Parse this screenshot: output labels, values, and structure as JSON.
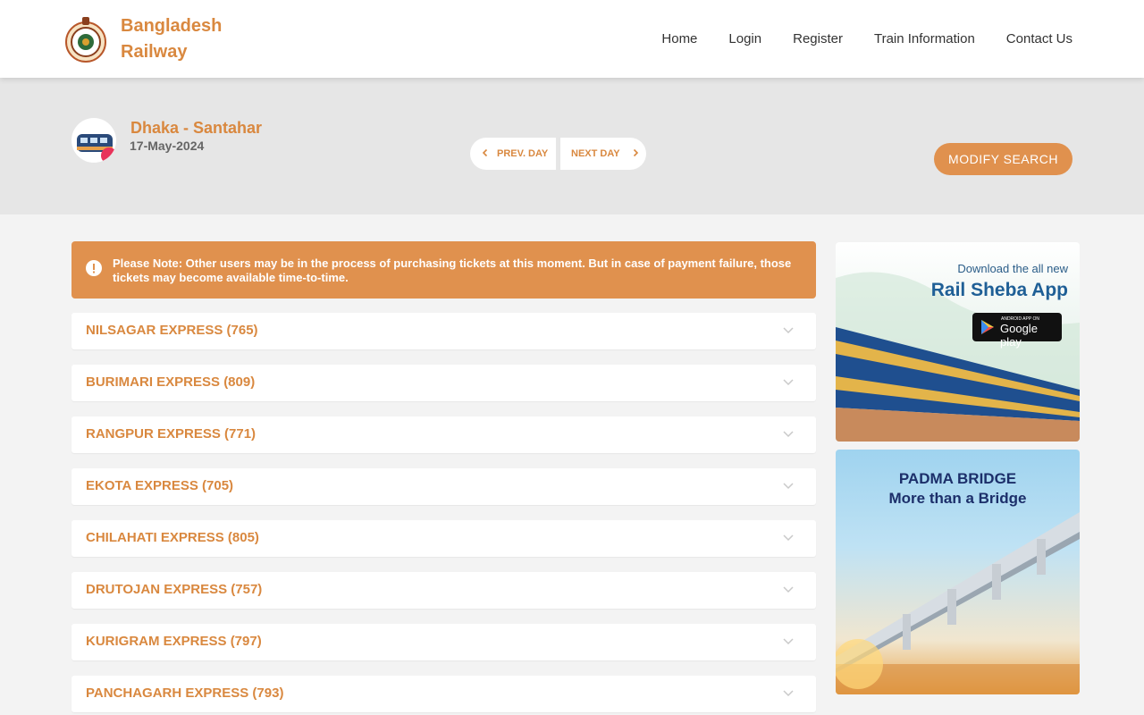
{
  "header": {
    "brand_line1": "Bangladesh",
    "brand_line2": "Railway",
    "nav": [
      {
        "label": "Home"
      },
      {
        "label": "Login"
      },
      {
        "label": "Register"
      },
      {
        "label": "Train Information"
      },
      {
        "label": "Contact Us"
      }
    ]
  },
  "journey": {
    "route": "Dhaka - Santahar",
    "date": "17-May-2024",
    "prev_day": "PREV. DAY",
    "next_day": "NEXT DAY",
    "modify_search": "MODIFY SEARCH"
  },
  "notice": {
    "text": "Please Note: Other users may be in the process of purchasing tickets at this moment. But in case of payment failure, those tickets may become available time-to-time."
  },
  "trains": [
    {
      "name": "NILSAGAR EXPRESS (765)"
    },
    {
      "name": "BURIMARI EXPRESS (809)"
    },
    {
      "name": "RANGPUR EXPRESS (771)"
    },
    {
      "name": "EKOTA EXPRESS (705)"
    },
    {
      "name": "CHILAHATI EXPRESS (805)"
    },
    {
      "name": "DRUTOJAN EXPRESS (757)"
    },
    {
      "name": "KURIGRAM EXPRESS (797)"
    },
    {
      "name": "PANCHAGARH EXPRESS (793)"
    }
  ],
  "ads": {
    "app_line1": "Download the all new",
    "app_line2": "Rail Sheba App",
    "gplay_sub": "ANDROID APP ON",
    "gplay_main": "Google play",
    "bridge_line1": "PADMA BRIDGE",
    "bridge_line2": "More than a Bridge"
  },
  "colors": {
    "accent": "#d9883f",
    "button": "#e0914e"
  }
}
